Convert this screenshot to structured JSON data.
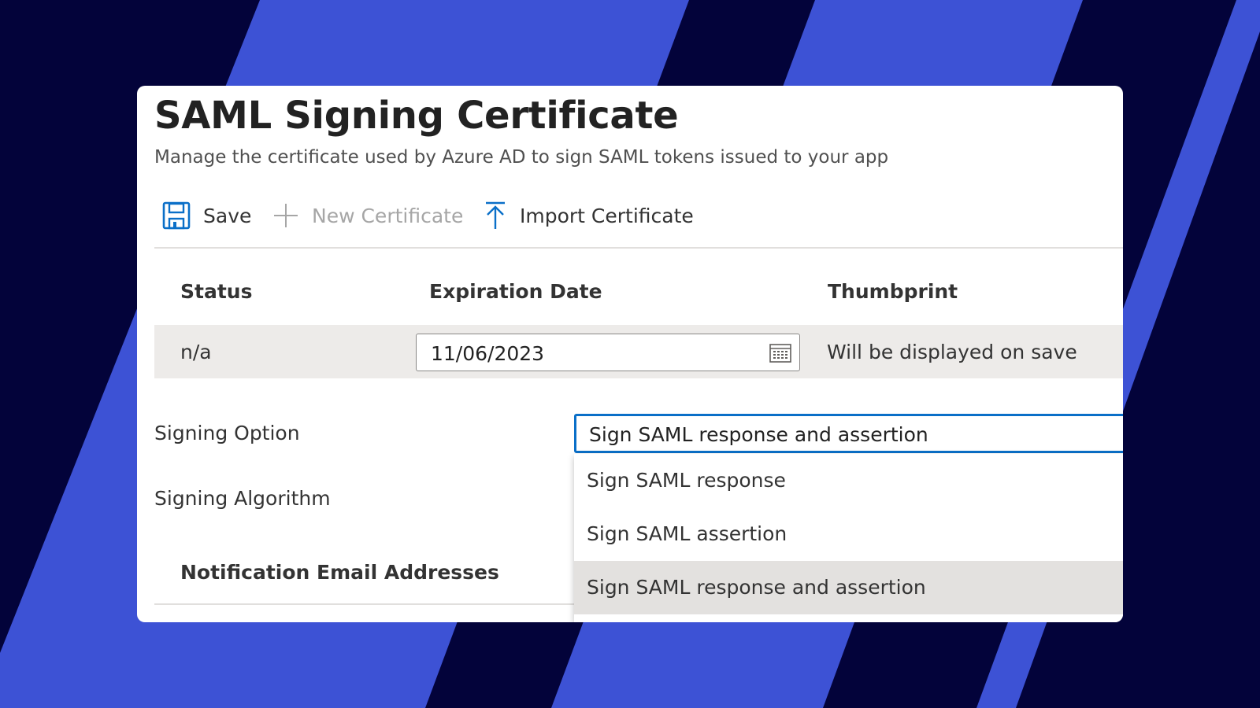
{
  "header": {
    "title": "SAML Signing Certificate",
    "subtitle": "Manage the certificate used by Azure AD to sign SAML tokens issued to your app"
  },
  "toolbar": {
    "save_label": "Save",
    "new_certificate_label": "New Certificate",
    "import_certificate_label": "Import Certificate"
  },
  "table": {
    "columns": [
      "Status",
      "Expiration Date",
      "Thumbprint"
    ],
    "row": {
      "status": "n/a",
      "expiration_date": "11/06/2023",
      "thumbprint": "Will be displayed on save"
    }
  },
  "form": {
    "signing_option_label": "Signing Option",
    "signing_option_value": "Sign SAML response and assertion",
    "signing_option_options": [
      "Sign SAML response",
      "Sign SAML assertion",
      "Sign SAML response and assertion"
    ],
    "signing_algorithm_label": "Signing Algorithm",
    "notification_email_heading": "Notification Email Addresses"
  },
  "colors": {
    "background_blue": "#3d52d5",
    "background_navy": "#03033a",
    "accent_blue": "#0a6fc8",
    "row_gray": "#edebe9",
    "selected_option": "#e3e1df"
  },
  "icons": {
    "save": "save-icon",
    "new_certificate": "plus-icon",
    "import_certificate": "upload-arrow-icon",
    "date_picker": "calendar-icon"
  }
}
